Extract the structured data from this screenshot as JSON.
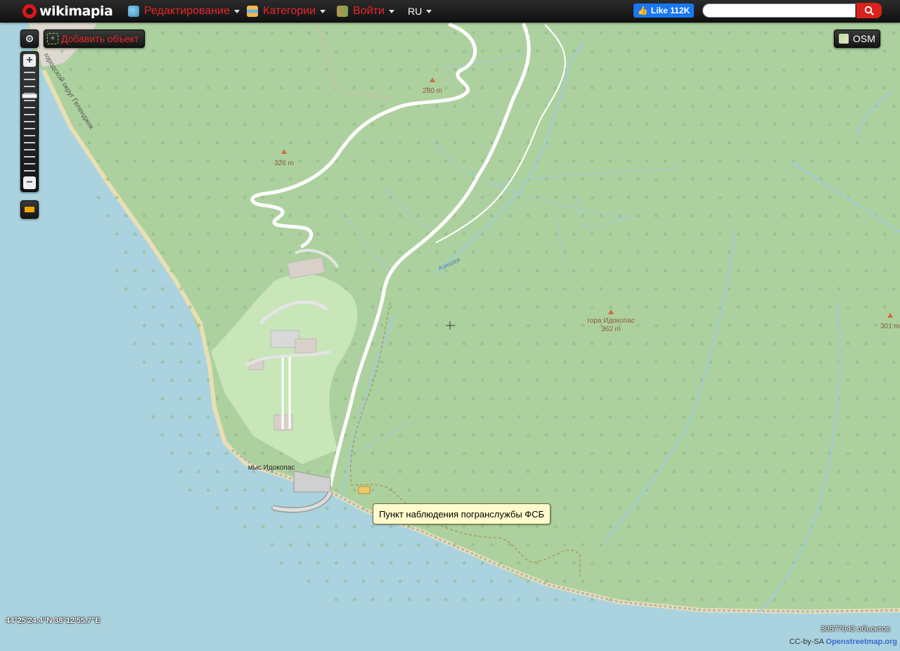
{
  "header": {
    "logo_text": "wikimapia",
    "menu": [
      {
        "label": "Редактирование",
        "icon": "edit-icon"
      },
      {
        "label": "Категории",
        "icon": "categories-icon"
      },
      {
        "label": "Войти",
        "icon": "login-icon"
      }
    ],
    "language": "RU",
    "facebook_like": "Like 112K",
    "search": {
      "value": "",
      "placeholder": ""
    }
  },
  "controls": {
    "add_object_label": "Добавить объект",
    "map_type_label": "OSM",
    "zoom_in": "+",
    "zoom_out": "−"
  },
  "map": {
    "peaks": [
      {
        "name": "",
        "elevation": "280 m"
      },
      {
        "name": "",
        "elevation": "326 m"
      },
      {
        "name": "гора Идокопас",
        "elevation": "362 m"
      },
      {
        "name": "",
        "elevation": "301 m"
      }
    ],
    "cape_label": "мыс Идокопас",
    "road_label": "городской округ Геленджик",
    "stream_label": "Азишаж",
    "tooltip": "Пункт наблюдения погранслужбы ФСБ"
  },
  "footer": {
    "coordinates": "44°25'24.4\"N 38°12'55.7\"E",
    "object_count": "30577643 объектов",
    "attribution_prefix": "CC-by-SA",
    "attribution_link": "Openstreetmap.org"
  },
  "colors": {
    "sea": "#aad3df",
    "forest": "#add19e",
    "brand_red": "#e8262b",
    "water_line": "#9fcbe0",
    "peak_marker": "#d26a3a"
  }
}
